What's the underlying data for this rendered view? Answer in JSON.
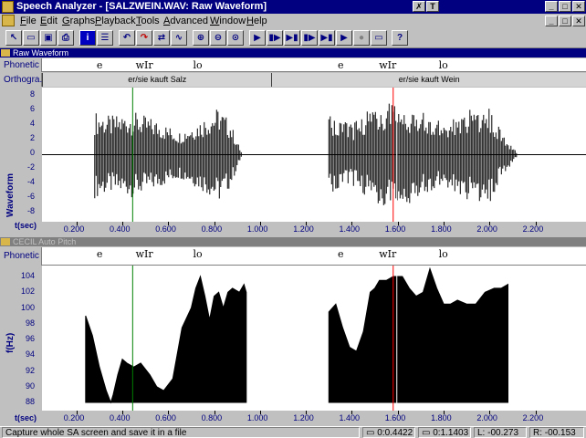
{
  "window": {
    "title": "Speech Analyzer - [SALZWEIN.WAV: Raw Waveform]",
    "controls": [
      "?",
      "✗",
      "T"
    ],
    "mdi_controls": [
      "_",
      "□",
      "✕"
    ]
  },
  "menu": [
    "File",
    "Edit",
    "Graphs",
    "Playback",
    "Tools",
    "Advanced",
    "Window",
    "Help"
  ],
  "toolbar_icons": [
    "arrow-icon",
    "open-icon",
    "save-icon",
    "print-icon",
    "info-icon",
    "layout-icon",
    "undo-icon",
    "redo-icon",
    "cursor-icon",
    "waveform-icon",
    "zoom-in-icon",
    "zoom-out-icon",
    "zoom-all-icon",
    "play-icon",
    "play-segment-icon",
    "play-window-icon",
    "play-cursor-icon",
    "play-end-icon",
    "record-icon",
    "stop-icon",
    "help-icon"
  ],
  "waveform_pane": {
    "title": "Raw Waveform",
    "phonetic_label": "Phonetic",
    "ortho_label": "Orthogra.",
    "ylabel": "Waveform",
    "xlabel": "t(sec)",
    "phonetic_marks": [
      {
        "text": "e",
        "t": 0.32
      },
      {
        "text": "wIr",
        "t": 0.49
      },
      {
        "text": "lo",
        "t": 0.74
      },
      {
        "text": "e",
        "t": 1.37
      },
      {
        "text": "wIr",
        "t": 1.55
      },
      {
        "text": "lo",
        "t": 1.81
      }
    ],
    "ortho_segments": [
      {
        "text": "er/sie kauft Salz",
        "start": 0.05,
        "end": 1.05
      },
      {
        "text": "er/sie kauft Wein",
        "start": 1.05,
        "end": 2.42
      }
    ],
    "yticks": [
      "8",
      "6",
      "4",
      "2",
      "0",
      "-2",
      "-4",
      "-6",
      "-8"
    ],
    "xticks": [
      "0.200",
      "0.400",
      "0.600",
      "0.800",
      "1.000",
      "1.200",
      "1.400",
      "1.600",
      "1.800",
      "2.000",
      "2.200"
    ]
  },
  "pitch_pane": {
    "title": "CECIL Auto Pitch",
    "phonetic_label": "Phonetic",
    "ylabel": "f(Hz)",
    "xlabel": "t(sec)",
    "phonetic_marks": [
      {
        "text": "e",
        "t": 0.32
      },
      {
        "text": "wIr",
        "t": 0.49
      },
      {
        "text": "lo",
        "t": 0.74
      },
      {
        "text": "e",
        "t": 1.37
      },
      {
        "text": "wIr",
        "t": 1.55
      },
      {
        "text": "lo",
        "t": 1.81
      }
    ],
    "yticks": [
      "104",
      "102",
      "100",
      "98",
      "96",
      "94",
      "92",
      "90",
      "88"
    ],
    "xticks": [
      "0.200",
      "0.400",
      "0.600",
      "0.800",
      "1.000",
      "1.200",
      "1.400",
      "1.600",
      "1.800",
      "2.000",
      "2.200"
    ]
  },
  "chart_data": [
    {
      "type": "area",
      "ylabel": "Waveform",
      "xlabel": "t(sec)",
      "xlim": [
        0.05,
        2.42
      ],
      "ylim": [
        -10,
        10
      ],
      "envelope_segments": [
        {
          "x": [
            0.28,
            0.35,
            0.45,
            0.55,
            0.65,
            0.75,
            0.82,
            0.87,
            0.92
          ],
          "amp": [
            6.5,
            5.8,
            6.4,
            5.2,
            3.5,
            5.5,
            7.2,
            5.0,
            0.3
          ]
        },
        {
          "x": [
            1.3,
            1.4,
            1.5,
            1.6,
            1.7,
            1.8,
            1.9,
            2.0,
            2.05,
            2.12
          ],
          "amp": [
            6.0,
            4.5,
            7.5,
            8.0,
            6.5,
            4.8,
            6.8,
            7.3,
            3.5,
            0.3
          ]
        }
      ],
      "cursors": [
        {
          "t": 0.445,
          "color": "#008000"
        },
        {
          "t": 1.58,
          "color": "#ff0000"
        }
      ]
    },
    {
      "type": "area",
      "ylabel": "f(Hz)",
      "xlabel": "t(sec)",
      "xlim": [
        0.05,
        2.42
      ],
      "ylim": [
        88,
        106
      ],
      "series": [
        {
          "x": [
            0.24,
            0.27,
            0.3,
            0.33,
            0.35,
            0.36,
            0.38,
            0.4,
            0.42,
            0.45,
            0.48,
            0.52,
            0.55,
            0.58,
            0.62,
            0.66,
            0.7,
            0.72,
            0.74,
            0.76,
            0.78,
            0.8,
            0.82,
            0.84,
            0.86,
            0.88,
            0.91,
            0.93,
            0.94
          ],
          "y": [
            99.0,
            96.5,
            92.5,
            89.5,
            88.0,
            89.0,
            91.5,
            93.5,
            93.0,
            92.5,
            93.0,
            91.5,
            90.0,
            89.5,
            91.0,
            97.5,
            100.0,
            102.5,
            104.0,
            101.5,
            98.5,
            101.5,
            102.0,
            100.0,
            102.0,
            102.5,
            102.0,
            103.0,
            102.0
          ]
        },
        {
          "x": [
            1.3,
            1.33,
            1.36,
            1.39,
            1.42,
            1.45,
            1.48,
            1.5,
            1.52,
            1.55,
            1.58,
            1.62,
            1.65,
            1.68,
            1.71,
            1.74,
            1.77,
            1.8,
            1.83,
            1.86,
            1.9,
            1.94,
            1.98,
            2.02,
            2.05,
            2.08
          ],
          "y": [
            99.5,
            100.5,
            97.5,
            95.0,
            94.5,
            97.0,
            102.0,
            102.5,
            103.5,
            103.5,
            104.0,
            104.0,
            102.5,
            101.5,
            102.0,
            105.0,
            102.5,
            100.5,
            100.5,
            101.0,
            100.5,
            100.5,
            102.0,
            102.5,
            102.5,
            103.0
          ]
        }
      ],
      "cursors": [
        {
          "t": 0.445,
          "color": "#008000"
        },
        {
          "t": 1.58,
          "color": "#ff0000"
        }
      ]
    }
  ],
  "status": {
    "message": "Capture whole SA screen and save it in a file",
    "field1": "0:0.4422",
    "field2": "0:1.1403",
    "field3": "L: -00.273",
    "field4": "R: -00.153"
  }
}
